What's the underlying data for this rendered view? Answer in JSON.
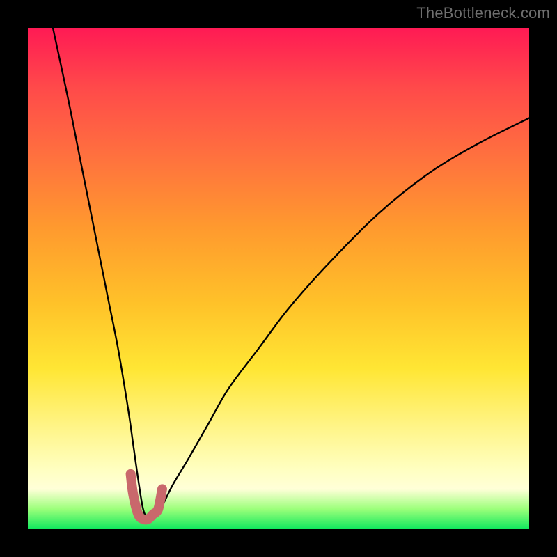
{
  "watermark": "TheBottleneck.com",
  "chart_data": {
    "type": "line",
    "title": "",
    "xlabel": "",
    "ylabel": "",
    "xlim": [
      0,
      100
    ],
    "ylim": [
      0,
      100
    ],
    "grid": false,
    "legend": false,
    "series": [
      {
        "name": "bottleneck-curve",
        "color": "#000000",
        "x": [
          5,
          8,
          10,
          12,
          14,
          16,
          18,
          20,
          21,
          22,
          23,
          24,
          25,
          26,
          27,
          29,
          32,
          36,
          40,
          46,
          52,
          60,
          70,
          80,
          90,
          100
        ],
        "y": [
          100,
          86,
          76,
          66,
          56,
          46,
          36,
          24,
          17,
          10,
          4,
          2,
          2,
          3,
          5,
          9,
          14,
          21,
          28,
          36,
          44,
          53,
          63,
          71,
          77,
          82
        ]
      },
      {
        "name": "valley-highlight",
        "color": "#c9686c",
        "x": [
          20.5,
          21,
          22,
          23,
          24,
          25,
          26,
          26.8
        ],
        "y": [
          11,
          7,
          3,
          2,
          2,
          3,
          4,
          8
        ]
      }
    ],
    "background_gradient": {
      "top": "#ff1a54",
      "mid1": "#ff9a2e",
      "mid2": "#ffe634",
      "low": "#ffffc0",
      "bottom": "#10e85e"
    }
  }
}
